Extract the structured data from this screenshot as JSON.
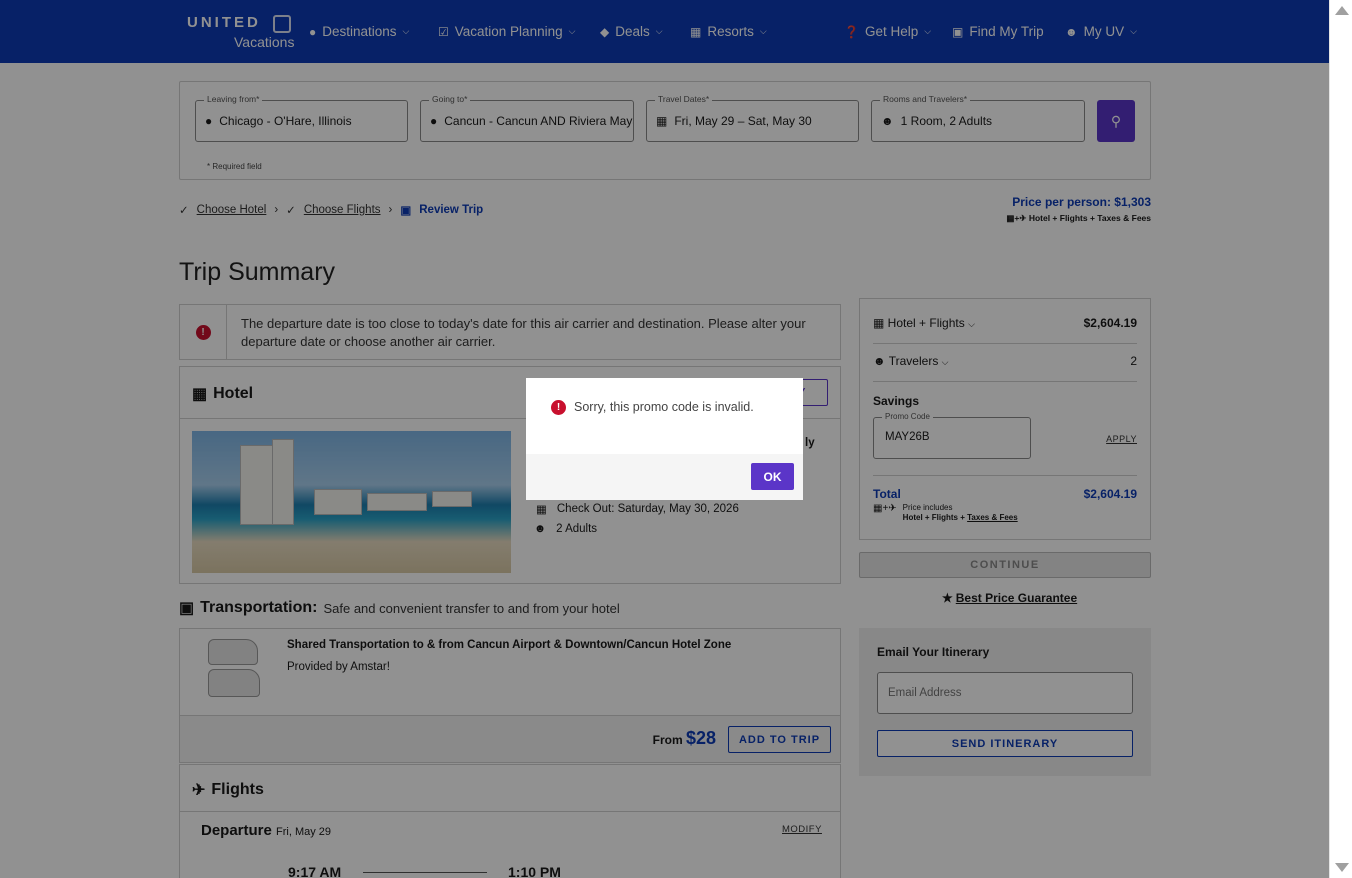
{
  "header": {
    "logo_top": "UNITED",
    "logo_bottom": "Vacations",
    "nav": [
      {
        "label": "Destinations",
        "icon": "pin-icon"
      },
      {
        "label": "Vacation Planning",
        "icon": "checklist-icon"
      },
      {
        "label": "Deals",
        "icon": "tag-icon"
      },
      {
        "label": "Resorts",
        "icon": "building-icon"
      }
    ],
    "right_nav": [
      {
        "label": "Get Help",
        "icon": "help-icon"
      },
      {
        "label": "Find My Trip",
        "icon": "suitcase-icon"
      },
      {
        "label": "My UV",
        "icon": "user-icon"
      }
    ]
  },
  "search": {
    "leaving_label": "Leaving from*",
    "leaving_value": "Chicago - O'Hare, Illinois",
    "going_label": "Going to*",
    "going_value": "Cancun - Cancun AND Riviera Maya",
    "dates_label": "Travel Dates*",
    "dates_value": "Fri, May 29 – Sat, May 30",
    "rooms_label": "Rooms and Travelers*",
    "rooms_value": "1 Room, 2 Adults",
    "required_note": "* Required field"
  },
  "breadcrumbs": {
    "step1": "Choose Hotel",
    "step2": "Choose Flights",
    "step3": "Review Trip"
  },
  "price_per_person": "Price per person: $1,303",
  "price_includes": "Hotel + Flights + Taxes & Fees",
  "page_title": "Trip Summary",
  "alert_message": "The departure date is too close to today's date for this air carrier and destination. Please alter your departure date or choose another air carrier.",
  "hotel": {
    "heading": "Hotel",
    "modify_partial": "FY",
    "name_partial": "ly",
    "check_out": "Check Out: Saturday, May 30, 2026",
    "guests": "2 Adults"
  },
  "transportation": {
    "heading": "Transportation:",
    "subheading": "Safe and convenient transfer to and from your hotel",
    "title": "Shared Transportation to & from Cancun Airport & Downtown/Cancun Hotel Zone",
    "provider": "Provided by Amstar!",
    "from_label": "From",
    "from_price": "$28",
    "add_button": "ADD TO TRIP"
  },
  "flights": {
    "heading": "Flights",
    "departure_label": "Departure",
    "departure_date": "Fri, May 29",
    "modify": "MODIFY",
    "depart_time": "9:17 AM",
    "arrive_time": "1:10 PM"
  },
  "summary": {
    "hotel_flights_label": "Hotel + Flights",
    "hotel_flights_value": "$2,604.19",
    "travelers_label": "Travelers",
    "travelers_value": "2",
    "savings_label": "Savings",
    "promo_label": "Promo Code",
    "promo_value": "MAY26B",
    "apply_label": "APPLY",
    "total_label": "Total",
    "total_value": "$2,604.19",
    "price_includes_label": "Price includes",
    "price_includes_prefix": "Hotel + Flights + ",
    "taxes_link": "Taxes & Fees"
  },
  "continue_label": "CONTINUE",
  "guarantee_label": "Best Price Guarantee",
  "email": {
    "heading": "Email Your Itinerary",
    "placeholder": "Email Address",
    "send_label": "SEND ITINERARY"
  },
  "modal": {
    "message": "Sorry, this promo code is invalid.",
    "ok_label": "OK"
  }
}
